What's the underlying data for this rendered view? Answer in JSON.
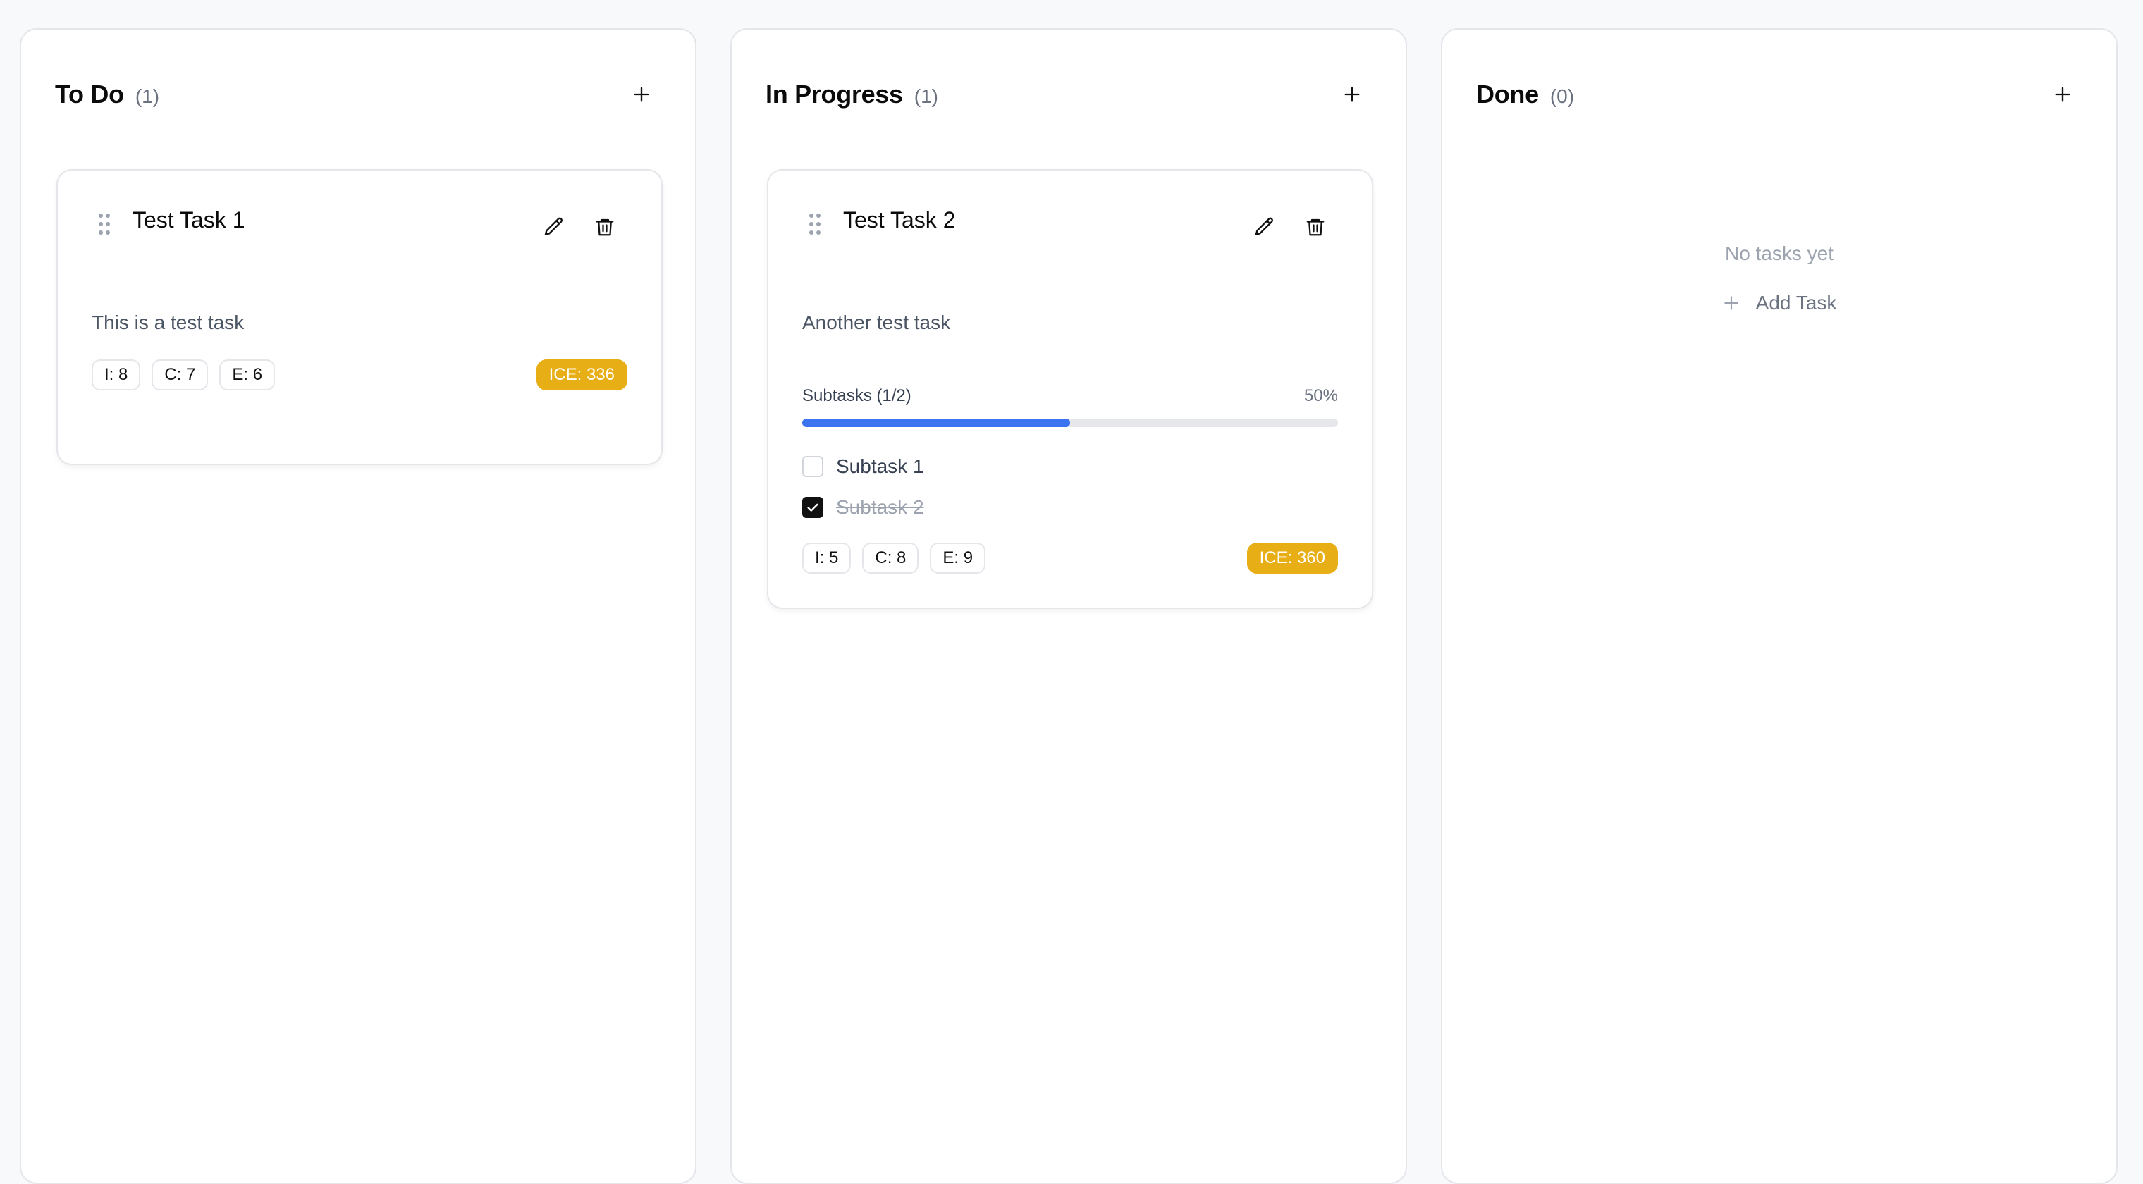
{
  "columns": [
    {
      "title": "To Do",
      "count": "(1)",
      "add_icon": "plus-icon",
      "cards": [
        {
          "title": "Test Task 1",
          "description": "This is a test task",
          "impact": "I: 8",
          "confidence": "C: 7",
          "ease": "E: 6",
          "ice": "ICE: 336"
        }
      ]
    },
    {
      "title": "In Progress",
      "count": "(1)",
      "add_icon": "plus-icon",
      "cards": [
        {
          "title": "Test Task 2",
          "description": "Another test task",
          "subtasks_label": "Subtasks (1/2)",
          "progress_text": "50%",
          "progress_fraction": 0.5,
          "subtasks": [
            {
              "label": "Subtask 1",
              "checked": false
            },
            {
              "label": "Subtask 2",
              "checked": true
            }
          ],
          "impact": "I: 5",
          "confidence": "C: 8",
          "ease": "E: 9",
          "ice": "ICE: 360"
        }
      ]
    },
    {
      "title": "Done",
      "count": "(0)",
      "add_icon": "plus-icon",
      "empty_text": "No tasks yet",
      "add_task_label": "Add Task"
    }
  ],
  "icons": {
    "drag": "drag-handle-icon",
    "edit": "pencil-icon",
    "delete": "trash-icon",
    "check": "check-icon"
  },
  "colors": {
    "ice_badge": "#e8ae16",
    "progress": "#3b73f0",
    "progress_track": "#e5e7eb",
    "border": "#e4e6ea"
  }
}
